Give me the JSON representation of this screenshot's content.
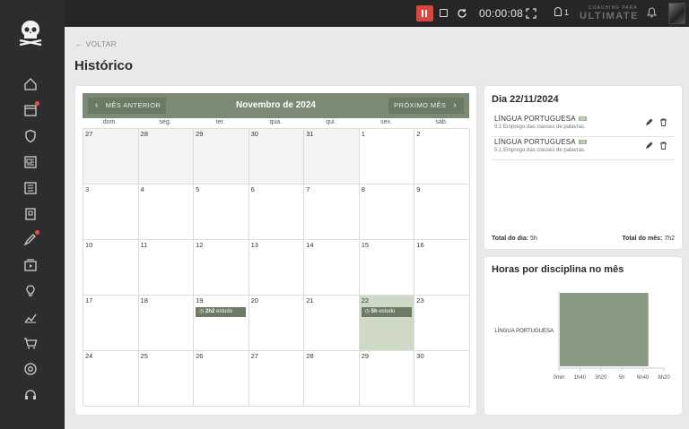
{
  "topbar": {
    "timer": "00:00:08",
    "pin_count": "1",
    "brand_small": "COACHING PARA",
    "brand_big": "ULTIMATE"
  },
  "back_label": "VOLTAR",
  "page_title": "Histórico",
  "calendar": {
    "prev_label": "MÊS ANTERIOR",
    "next_label": "PRÓXIMO MÊS",
    "month_label": "Novembro de 2024",
    "weekdays": [
      "dom.",
      "seg.",
      "ter.",
      "qua.",
      "qui.",
      "sex.",
      "sáb."
    ],
    "weeks": [
      [
        "27",
        "28",
        "29",
        "30",
        "31",
        "1",
        "2"
      ],
      [
        "3",
        "4",
        "5",
        "6",
        "7",
        "8",
        "9"
      ],
      [
        "10",
        "11",
        "12",
        "13",
        "14",
        "15",
        "16"
      ],
      [
        "17",
        "18",
        "19",
        "20",
        "21",
        "22",
        "23"
      ],
      [
        "24",
        "25",
        "26",
        "27",
        "28",
        "29",
        "30"
      ]
    ],
    "events": [
      {
        "week": 3,
        "day": 2,
        "duration": "2h2",
        "label": "estudo"
      },
      {
        "week": 3,
        "day": 5,
        "duration": "5h",
        "label": "estudo"
      }
    ]
  },
  "day_panel": {
    "title": "Dia 22/11/2024",
    "entries": [
      {
        "subject": "LÍNGUA PORTUGUESA",
        "badge": "5h",
        "topic": "5.1 Emprego das classes de palavras."
      },
      {
        "subject": "LÍNGUA PORTUGUESA",
        "badge": "1h",
        "topic": "5.1 Emprego das classes de palavras."
      }
    ],
    "total_day_label": "Total do dia:",
    "total_day_value": "5h",
    "total_month_label": "Total do mês:",
    "total_month_value": "7h2"
  },
  "chart_card": {
    "title": "Horas por disciplina no mês"
  },
  "chart_data": {
    "type": "bar",
    "orientation": "horizontal",
    "categories": [
      "LÍNGUA PORTUGUESA"
    ],
    "values": [
      7.03
    ],
    "unit": "hours",
    "xlim": [
      0,
      8.33
    ],
    "xticks": [
      "0min",
      "1h40",
      "3h20",
      "5h",
      "6h40",
      "8h20"
    ],
    "color": "#8a9a82",
    "grid": false,
    "title": "Horas por disciplina no mês"
  },
  "colors": {
    "accent": "#7a8a74",
    "selected_day": "#cfd9c6",
    "recording": "#d9463c"
  },
  "sidebar_icons": [
    "home-icon",
    "calendar-icon",
    "shield-icon",
    "news-icon",
    "list-icon",
    "note-icon",
    "edit-icon",
    "video-icon",
    "lightbulb-icon",
    "chart-icon",
    "cart-icon",
    "at-icon",
    "headset-icon"
  ]
}
